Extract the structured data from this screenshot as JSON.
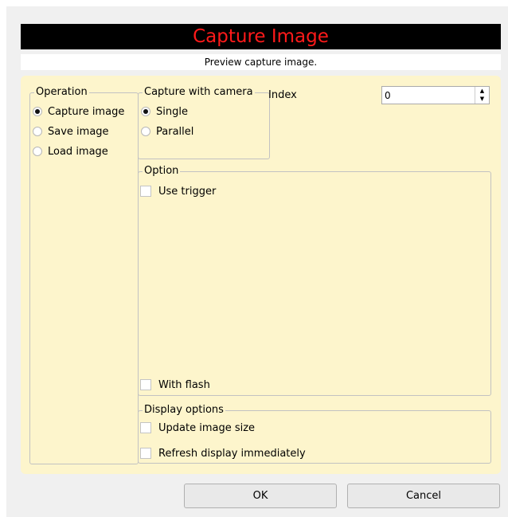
{
  "dialog": {
    "title": "Capture Image",
    "subtitle": "Preview capture image."
  },
  "operation": {
    "legend": "Operation",
    "options": [
      "Capture image",
      "Save image",
      "Load image"
    ],
    "selected": "Capture image"
  },
  "capture_with_camera": {
    "legend": "Capture with camera",
    "options": [
      "Single",
      "Parallel"
    ],
    "selected": "Single"
  },
  "index": {
    "label": "Index",
    "value": "0"
  },
  "option": {
    "legend": "Option",
    "use_trigger": {
      "label": "Use trigger",
      "checked": false
    },
    "with_flash": {
      "label": "With flash",
      "checked": false
    }
  },
  "display_options": {
    "legend": "Display options",
    "update_image_size": {
      "label": "Update image size",
      "checked": false
    },
    "refresh_display": {
      "label": "Refresh display immediately",
      "checked": false
    }
  },
  "buttons": {
    "ok": "OK",
    "cancel": "Cancel"
  },
  "colors": {
    "title_bg": "#000000",
    "title_text": "#ff1a1a",
    "panel_bg": "#fdf5cc"
  }
}
